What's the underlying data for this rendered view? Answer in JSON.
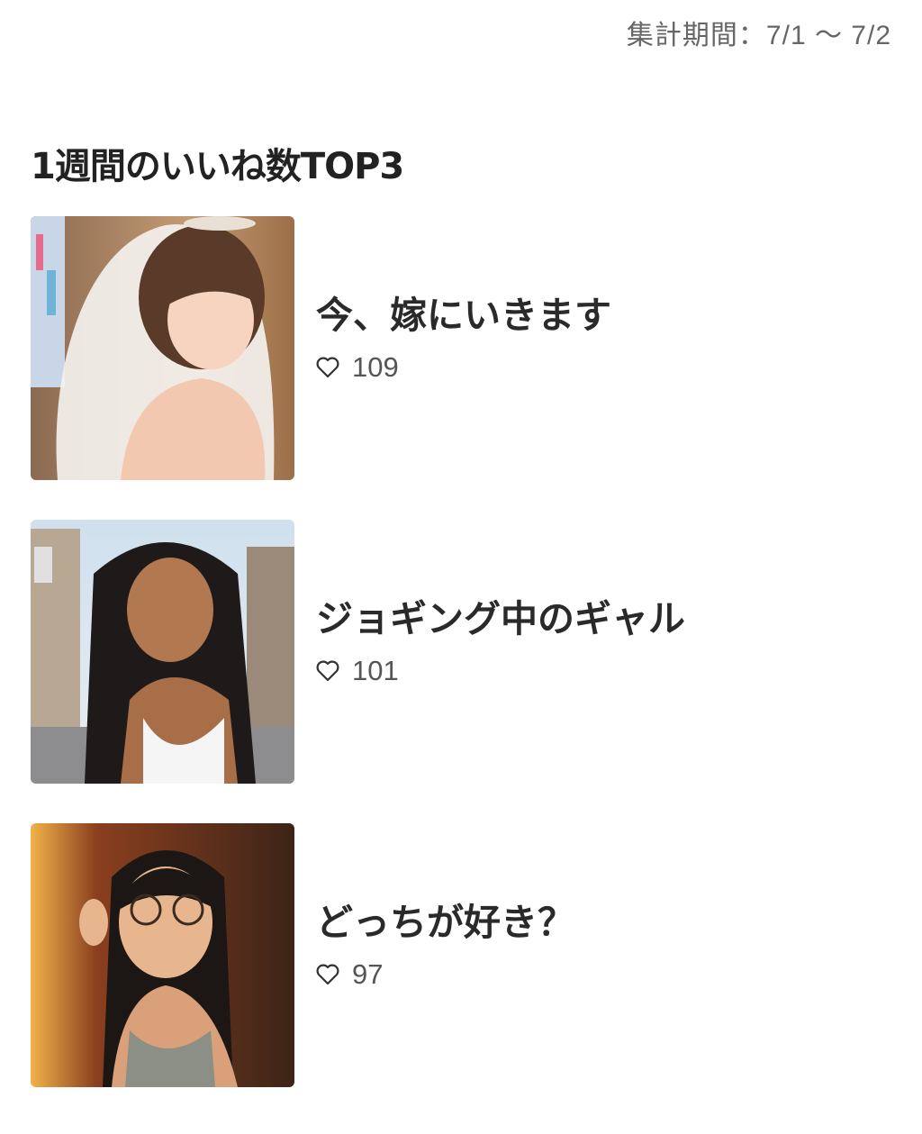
{
  "header": {
    "period_text": "集計期間：7/1 〜 7/2"
  },
  "section": {
    "title": "1週間のいいね数TOP3"
  },
  "ranking": [
    {
      "title": "今、嫁にいきます",
      "likes": "109",
      "icon": "heart-outline-icon",
      "image": "bride-illustration"
    },
    {
      "title": "ジョギング中のギャル",
      "likes": "101",
      "icon": "heart-outline-icon",
      "image": "jogging-gal-illustration"
    },
    {
      "title": "どっちが好き？",
      "likes": "97",
      "icon": "heart-outline-icon",
      "image": "glasses-girl-illustration"
    }
  ]
}
